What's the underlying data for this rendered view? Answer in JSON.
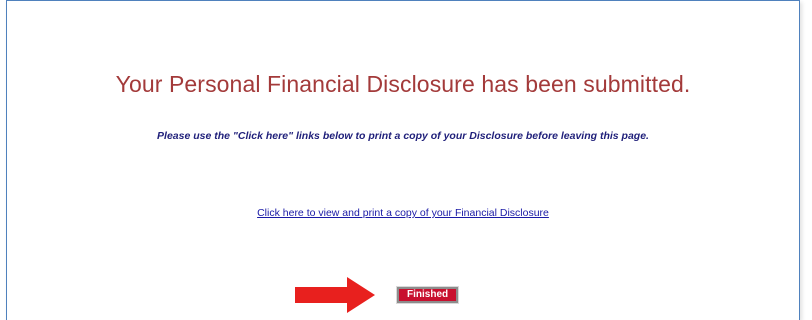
{
  "confirmation": {
    "heading": "Your Personal Financial Disclosure has been submitted.",
    "instruction": "Please use the \"Click here\" links below to print a copy of your Disclosure before leaving this page.",
    "print_link_text": "Click here to view and print a copy of your Financial Disclosure",
    "finished_label": "Finished"
  },
  "colors": {
    "heading": "#a33a3a",
    "instruction": "#1f1f7a",
    "link": "#1a1aa6",
    "finished_button": "#c8102e",
    "arrow": "#e8201e",
    "panel_border": "#4f81bd"
  },
  "icons": {
    "pointer_arrow": "red-right-arrow-icon"
  }
}
